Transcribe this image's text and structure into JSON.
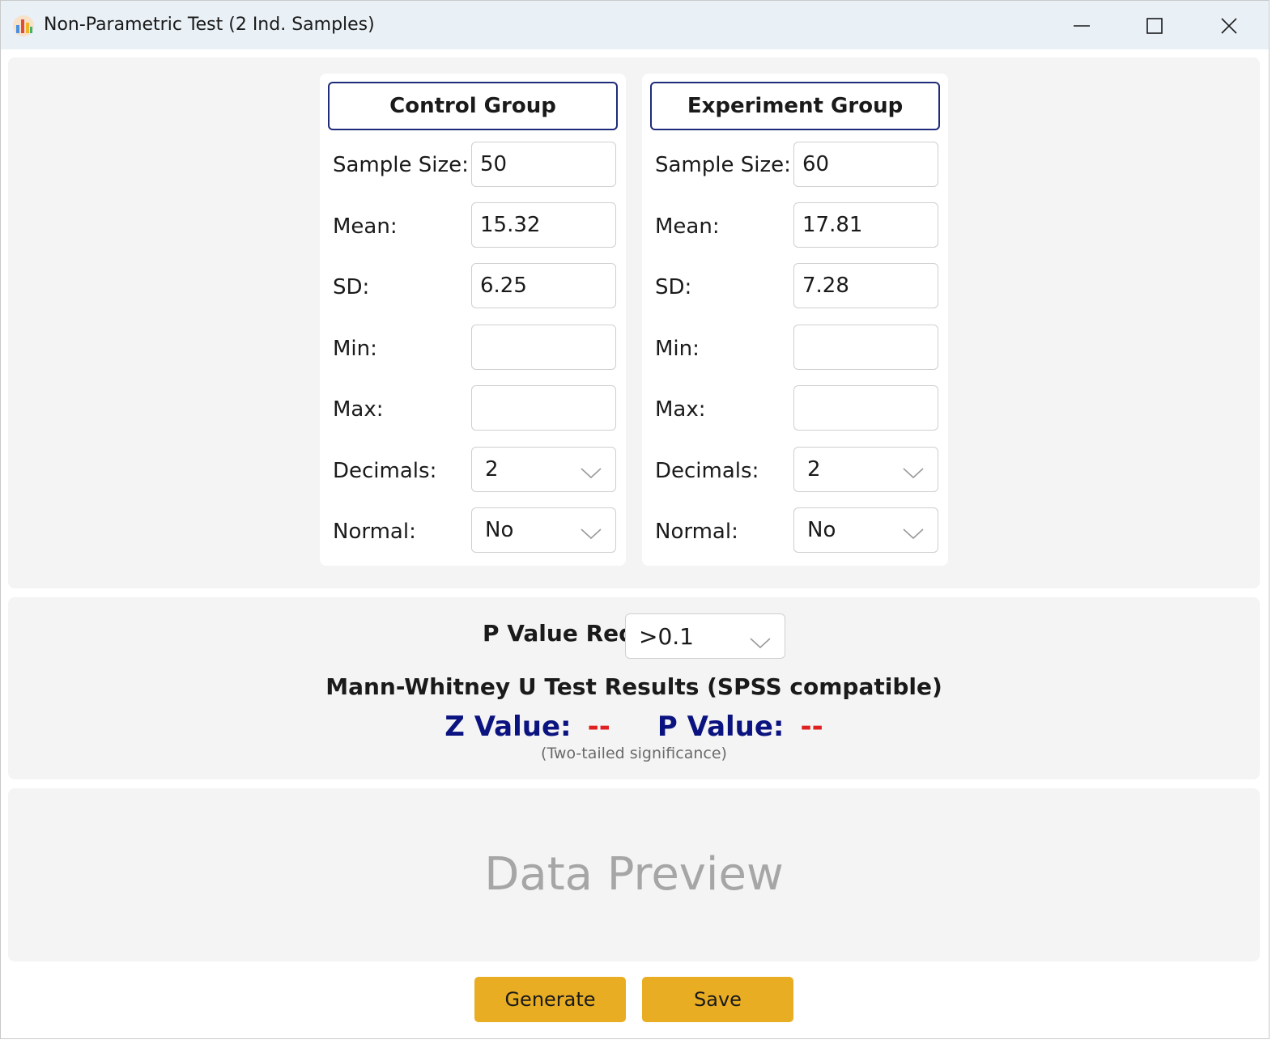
{
  "window": {
    "title": "Non-Parametric Test (2 Ind. Samples)"
  },
  "groups": [
    {
      "title": "Control Group",
      "sample_size_label": "Sample Size:",
      "sample_size": "50",
      "mean_label": "Mean:",
      "mean": "15.32",
      "sd_label": "SD:",
      "sd": "6.25",
      "min_label": "Min:",
      "min": "",
      "max_label": "Max:",
      "max": "",
      "decimals_label": "Decimals:",
      "decimals": "2",
      "normal_label": "Normal:",
      "normal": "No"
    },
    {
      "title": "Experiment Group",
      "sample_size_label": "Sample Size:",
      "sample_size": "60",
      "mean_label": "Mean:",
      "mean": "17.81",
      "sd_label": "SD:",
      "sd": "7.28",
      "min_label": "Min:",
      "min": "",
      "max_label": "Max:",
      "max": "",
      "decimals_label": "Decimals:",
      "decimals": "2",
      "normal_label": "Normal:",
      "normal": "No"
    }
  ],
  "pvalue_req": {
    "label": "P Value Req:",
    "value": ">0.1"
  },
  "results": {
    "title": "Mann-Whitney U Test Results (SPSS compatible)",
    "z_label": "Z Value:",
    "z_value": "--",
    "p_label": "P Value:",
    "p_value": "--",
    "note": "(Two-tailed significance)"
  },
  "preview": {
    "placeholder": "Data Preview"
  },
  "actions": {
    "generate_label": "Generate",
    "save_label": "Save"
  },
  "colors": {
    "accent_button": "#e8ad22",
    "result_label": "#0b1380",
    "result_value": "#e02020",
    "group_border": "#1f2a7a"
  }
}
